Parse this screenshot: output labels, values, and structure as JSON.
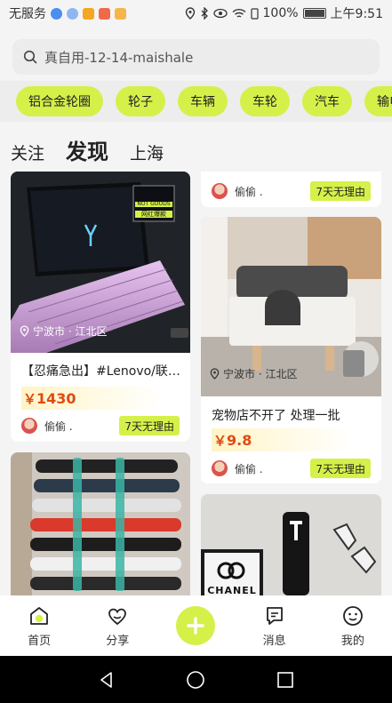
{
  "status_bar": {
    "carrier": "无服务",
    "battery": "100%",
    "time": "上午9:51"
  },
  "search": {
    "placeholder": "真自用-12-14-maishale"
  },
  "chips": [
    "铝合金轮圈",
    "轮子",
    "车辆",
    "车轮",
    "汽车",
    "输电"
  ],
  "tabs": [
    "关注",
    "发现",
    "上海"
  ],
  "active_tab": "发现",
  "cards": {
    "laptop": {
      "location": "宁波市 · 江北区",
      "title": "【忍痛急出】#Lenovo/联想拯救者",
      "price_symbol": "￥",
      "price": "1430",
      "seller": "偷偷 .",
      "badge": "7天无理由",
      "sticker_lines": [
        "NOT GOODS",
        "网红爆款"
      ]
    },
    "top_right": {
      "seller": "偷偷 .",
      "badge": "7天无理由"
    },
    "pet": {
      "location": "宁波市 · 江北区",
      "title": "宠物店不开了 处理一批",
      "price_symbol": "￥",
      "price": "9.8",
      "seller": "偷偷 .",
      "badge": "7天无理由"
    },
    "chanel": {
      "mat_text": "CHANEL"
    }
  },
  "bottom_nav": [
    {
      "label": "首页",
      "icon": "home-icon"
    },
    {
      "label": "分享",
      "icon": "heart-icon"
    },
    {
      "label": "",
      "icon": "add-icon"
    },
    {
      "label": "消息",
      "icon": "message-icon"
    },
    {
      "label": "我的",
      "icon": "profile-icon"
    }
  ],
  "colors": {
    "accent": "#d6f04a",
    "price": "#e14b12"
  }
}
